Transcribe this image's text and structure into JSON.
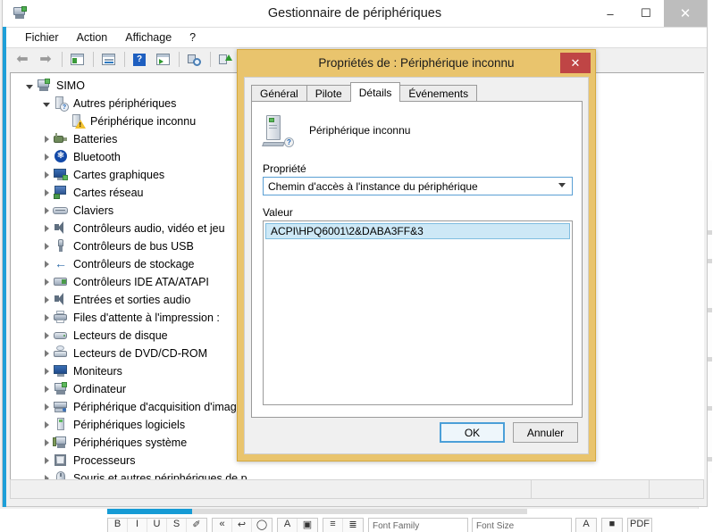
{
  "window": {
    "title": "Gestionnaire de périphériques",
    "icon": "device-manager-icon",
    "minimize": "–",
    "maximize": "☐",
    "close": "✕"
  },
  "menubar": {
    "items": [
      {
        "label": "Fichier"
      },
      {
        "label": "Action"
      },
      {
        "label": "Affichage"
      },
      {
        "label": "?"
      }
    ]
  },
  "toolbar": {
    "buttons": [
      {
        "name": "back-icon",
        "glyph": "⬅"
      },
      {
        "name": "forward-icon",
        "glyph": "➡"
      },
      {
        "name": "show-hidden-devices-icon",
        "glyph": "▤"
      },
      {
        "name": "properties-icon",
        "glyph": "▤"
      },
      {
        "name": "help-icon",
        "glyph": "?"
      },
      {
        "name": "scan-hardware-changes-icon",
        "glyph": "▤"
      },
      {
        "name": "update-driver-icon",
        "glyph": "⌕"
      },
      {
        "name": "enable-device-icon",
        "glyph": "↑"
      },
      {
        "name": "uninstall-device-icon",
        "glyph": "✕"
      }
    ]
  },
  "tree": {
    "items": [
      {
        "label": "SIMO",
        "indent": 0,
        "state": "expanded",
        "icon": "computer-icon"
      },
      {
        "label": "Autres périphériques",
        "indent": 1,
        "state": "expanded",
        "icon": "unknown-device-icon"
      },
      {
        "label": "Périphérique inconnu",
        "indent": 2,
        "state": "leaf",
        "icon": "warning-device-icon"
      },
      {
        "label": "Batteries",
        "indent": 1,
        "state": "collapsed",
        "icon": "battery-icon"
      },
      {
        "label": "Bluetooth",
        "indent": 1,
        "state": "collapsed",
        "icon": "bluetooth-icon"
      },
      {
        "label": "Cartes graphiques",
        "indent": 1,
        "state": "collapsed",
        "icon": "display-adapter-icon"
      },
      {
        "label": "Cartes réseau",
        "indent": 1,
        "state": "collapsed",
        "icon": "network-adapter-icon"
      },
      {
        "label": "Claviers",
        "indent": 1,
        "state": "collapsed",
        "icon": "keyboard-icon"
      },
      {
        "label": "Contrôleurs audio, vidéo et jeu",
        "indent": 1,
        "state": "collapsed",
        "icon": "sound-icon"
      },
      {
        "label": "Contrôleurs de bus USB",
        "indent": 1,
        "state": "collapsed",
        "icon": "usb-icon"
      },
      {
        "label": "Contrôleurs de stockage",
        "indent": 1,
        "state": "collapsed",
        "icon": "storage-controller-icon"
      },
      {
        "label": "Contrôleurs IDE ATA/ATAPI",
        "indent": 1,
        "state": "collapsed",
        "icon": "ide-controller-icon"
      },
      {
        "label": "Entrées et sorties audio",
        "indent": 1,
        "state": "collapsed",
        "icon": "audio-io-icon"
      },
      {
        "label": "Files d'attente à l'impression :",
        "indent": 1,
        "state": "collapsed",
        "icon": "print-queue-icon"
      },
      {
        "label": "Lecteurs de disque",
        "indent": 1,
        "state": "collapsed",
        "icon": "disk-drive-icon"
      },
      {
        "label": "Lecteurs de DVD/CD-ROM",
        "indent": 1,
        "state": "collapsed",
        "icon": "dvd-drive-icon"
      },
      {
        "label": "Moniteurs",
        "indent": 1,
        "state": "collapsed",
        "icon": "monitor-icon"
      },
      {
        "label": "Ordinateur",
        "indent": 1,
        "state": "collapsed",
        "icon": "computer-icon"
      },
      {
        "label": "Périphérique d'acquisition d'image",
        "indent": 1,
        "state": "collapsed",
        "icon": "imaging-device-icon"
      },
      {
        "label": "Périphériques logiciels",
        "indent": 1,
        "state": "collapsed",
        "icon": "software-device-icon"
      },
      {
        "label": "Périphériques système",
        "indent": 1,
        "state": "collapsed",
        "icon": "system-device-icon"
      },
      {
        "label": "Processeurs",
        "indent": 1,
        "state": "collapsed",
        "icon": "processor-icon"
      },
      {
        "label": "Souris et autres périphériques de p",
        "indent": 1,
        "state": "collapsed",
        "icon": "mouse-icon"
      }
    ]
  },
  "dialog": {
    "title": "Propriétés de : Périphérique inconnu",
    "close_label": "✕",
    "tabs": [
      {
        "label": "Général",
        "active": false
      },
      {
        "label": "Pilote",
        "active": false
      },
      {
        "label": "Détails",
        "active": true
      },
      {
        "label": "Événements",
        "active": false
      }
    ],
    "device_name": "Périphérique inconnu",
    "property_label": "Propriété",
    "property_selected": "Chemin d'accès à l'instance du périphérique",
    "value_label": "Valeur",
    "value_selected": "ACPI\\HPQ6001\\2&DABA3FF&3",
    "ok_label": "OK",
    "cancel_label": "Annuler"
  },
  "statusbar": {
    "left": "",
    "middle": "",
    "right": ""
  },
  "bottom_app": {
    "toolbar_icons": [
      "B",
      "I",
      "U",
      "S",
      "✐",
      "«",
      "↩",
      "◯",
      "A",
      "▣",
      "≡",
      "≣"
    ],
    "font_family_placeholder": "Font Family",
    "font_size_placeholder": "Font Size",
    "extra_icons": [
      "A",
      "■",
      "PDF"
    ]
  },
  "colors": {
    "dialog_frame": "#e9c46d",
    "dialog_close": "#bf4545",
    "accent_blue": "#1e9fd8",
    "selection_blue": "#cde8f6",
    "combo_border": "#5a9fd4"
  }
}
